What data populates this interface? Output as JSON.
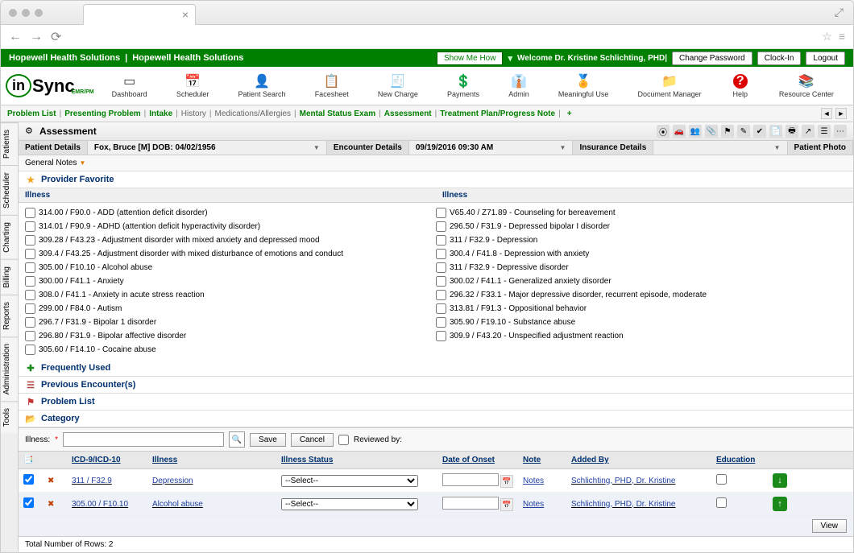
{
  "browser": {
    "tab_close": "×",
    "expand": "⤢"
  },
  "greenbar": {
    "org1": "Hopewell Health Solutions",
    "org2": "Hopewell Health Solutions",
    "showme": "Show Me How",
    "welcome": "Welcome Dr. Kristine Schlichting, PHD|",
    "change_pw": "Change Password",
    "clockin": "Clock-In",
    "logout": "Logout"
  },
  "logo": {
    "in": "in",
    "sync": "Sync",
    "sub": "EMR/PM"
  },
  "toolbar": [
    {
      "label": "Dashboard",
      "icon": "▭"
    },
    {
      "label": "Scheduler",
      "icon": "📅"
    },
    {
      "label": "Patient Search",
      "icon": "👤"
    },
    {
      "label": "Facesheet",
      "icon": "📋"
    },
    {
      "label": "New Charge",
      "icon": "🧾"
    },
    {
      "label": "Payments",
      "icon": "💲"
    },
    {
      "label": "Admin",
      "icon": "👔"
    },
    {
      "label": "Meaningful Use",
      "icon": "🏅"
    },
    {
      "label": "Document Manager",
      "icon": "📁"
    },
    {
      "label": "Help",
      "icon": "?"
    },
    {
      "label": "Resource Center",
      "icon": "📚"
    }
  ],
  "subnav": {
    "items": [
      {
        "label": "Problem List",
        "active": true
      },
      {
        "label": "Presenting Problem",
        "active": true
      },
      {
        "label": "Intake",
        "active": true
      },
      {
        "label": "History",
        "active": false
      },
      {
        "label": "Medications/Allergies",
        "active": false
      },
      {
        "label": "Mental Status Exam",
        "active": true
      },
      {
        "label": "Assessment",
        "active": true
      },
      {
        "label": "Treatment Plan/Progress Note",
        "active": true
      }
    ],
    "plus": "+"
  },
  "sidetabs": [
    "Patients",
    "Scheduler",
    "Charting",
    "Billing",
    "Reports",
    "Administration",
    "Tools"
  ],
  "page": {
    "title": "Assessment",
    "details": {
      "patient_label": "Patient Details",
      "patient_value": "Fox, Bruce [M] DOB: 04/02/1956",
      "encounter_label": "Encounter Details",
      "encounter_value": "09/19/2016 09:30 AM",
      "insurance_label": "Insurance Details",
      "photo_label": "Patient Photo"
    },
    "general_notes": "General Notes",
    "sections": {
      "favorite": "Provider Favorite",
      "frequently": "Frequently Used",
      "previous": "Previous Encounter(s)",
      "problem": "Problem List",
      "category": "Category"
    },
    "illness_header": "Illness",
    "illness_left": [
      "314.00 / F90.0 - ADD (attention deficit disorder)",
      "314.01 / F90.9 - ADHD (attention deficit hyperactivity disorder)",
      "309.28 / F43.23 - Adjustment disorder with mixed anxiety and depressed mood",
      "309.4 / F43.25 - Adjustment disorder with mixed disturbance of emotions and conduct",
      "305.00 / F10.10 - Alcohol abuse",
      "300.00 / F41.1 - Anxiety",
      "308.0 / F41.1 - Anxiety in acute stress reaction",
      "299.00 / F84.0 - Autism",
      "296.7 / F31.9 - Bipolar 1 disorder",
      "296.80 / F31.9 - Bipolar affective disorder",
      "305.60 / F14.10 - Cocaine abuse"
    ],
    "illness_right": [
      "V65.40 / Z71.89 - Counseling for bereavement",
      "296.50 / F31.9 - Depressed bipolar I disorder",
      "311 / F32.9 - Depression",
      "300.4 / F41.8 - Depression with anxiety",
      "311 / F32.9 - Depressive disorder",
      "300.02 / F41.1 - Generalized anxiety disorder",
      "296.32 / F33.1 - Major depressive disorder, recurrent episode, moderate",
      "313.81 / F91.3 - Oppositional behavior",
      "305.90 / F19.10 - Substance abuse",
      "309.9 / F43.20 - Unspecified adjustment reaction"
    ],
    "search": {
      "label": "Illness:",
      "save": "Save",
      "cancel": "Cancel",
      "reviewed": "Reviewed by:"
    },
    "table": {
      "headers": {
        "icd": "ICD-9/ICD-10",
        "illness": "Illness",
        "status": "Illness Status",
        "onset": "Date of Onset",
        "note": "Note",
        "added": "Added By",
        "edu": "Education"
      },
      "rows": [
        {
          "icd": "311 / F32.9",
          "illness": "Depression",
          "status": "--Select--",
          "note": "Notes",
          "added": "Schlichting, PHD, Dr. Kristine"
        },
        {
          "icd": "305.00 / F10.10",
          "illness": "Alcohol abuse",
          "status": "--Select--",
          "note": "Notes",
          "added": "Schlichting, PHD, Dr. Kristine"
        }
      ],
      "view": "View",
      "total": "Total Number of Rows: 2"
    }
  }
}
